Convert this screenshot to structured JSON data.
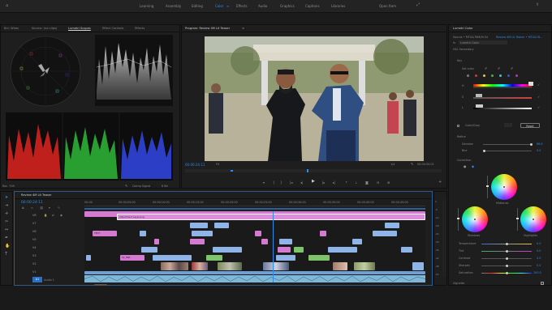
{
  "app": {
    "workspaces": [
      "Learning",
      "Assembly",
      "Editing",
      "Color",
      "Effects",
      "Audio",
      "Graphics",
      "Captions",
      "Libraries"
    ],
    "active_workspace": "Color",
    "open_label": "Open Item"
  },
  "source_panel": {
    "tabs": [
      "Bin: Wires",
      "Source: (no clips)",
      "Lumetri Scopes",
      "Effect Controls",
      "Effects"
    ],
    "active_tab": "Lumetri Scopes",
    "bottom_left": "Rec. 709",
    "bottom_mid": "Clamp Signal",
    "bottom_right": "8 Bit",
    "scale_left": [
      "100",
      "90",
      "80",
      "70",
      "60",
      "50",
      "40",
      "30",
      "20",
      "10",
      "0"
    ]
  },
  "program": {
    "title": "Program: Review 4M Lit Teaser",
    "menu_icon": "≡",
    "timecode": "00:00:24:11",
    "fit": "Fit",
    "ratio": "1/4",
    "duration": "00:00:50:01"
  },
  "lumetri": {
    "title": "Lumetri Color",
    "source": "Source • MTG&78M(M.S4",
    "clip": "Review 4M Lit Teaser • MTG&78...",
    "effect": "Lumetri Color",
    "hsl": "HSL Secondary",
    "key_label": "Key",
    "set_color": "Set color",
    "h_label": "H",
    "s_label": "S",
    "l_label": "L",
    "color_mode": "Color/Gray",
    "reset": "Reset",
    "refine_label": "Refine",
    "denoise_label": "Denoise",
    "denoise_val": "88.6",
    "blur_label": "Blur",
    "blur_val": "0.0",
    "correction_label": "Correction",
    "midtones": "Midtones",
    "shadows": "Shadows",
    "highlights": "Highlights",
    "sliders": [
      {
        "label": "Temperature",
        "value": "0.0"
      },
      {
        "label": "Tint",
        "value": "0.0"
      },
      {
        "label": "Contrast",
        "value": "0.0"
      },
      {
        "label": "Sharpen",
        "value": "0.0"
      },
      {
        "label": "Saturation",
        "value": "100.0"
      }
    ],
    "vignette": "Vignette"
  },
  "timeline": {
    "tab": "Review 4M Lit Teaser",
    "timecode": "00:00:24:11",
    "ruler": [
      "00:00",
      "00:00:05:00",
      "00:00:10:00",
      "00:00:15:00",
      "00:00:20:00",
      "00:00:25:00",
      "00:00:30:00",
      "00:00:35:00",
      "00:00:40:00",
      "00:00:45:00"
    ],
    "tracks": [
      "V8",
      "V7",
      "V6",
      "V5",
      "V4",
      "V3",
      "V2",
      "V1",
      "A1"
    ],
    "top_clip": "Adjustment Layer.png",
    "title_clip": "TEXT",
    "clip_v2": "S1_ERA",
    "audio_label": "Audio 1",
    "meter_db": [
      "0",
      "-6",
      "-12",
      "-18",
      "-24",
      "-30",
      "-36",
      "-42",
      "-48",
      "-54"
    ]
  },
  "colors": {
    "accent": "#2d8ceb",
    "pink_clip": "#d57ad0",
    "blue_clip": "#8fb4e8",
    "green_clip": "#7dc46a",
    "audio": "#7fb8d6"
  }
}
